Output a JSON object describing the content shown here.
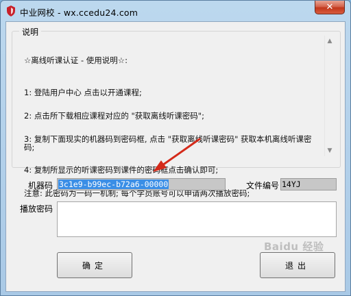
{
  "window": {
    "title": "中业网校 - wx.ccedu24.com",
    "close_symbol": "✕",
    "app_icon": "shield-icon"
  },
  "instructions": {
    "group_title": "说明",
    "heading": "☆离线听课认证 - 使用说明☆:",
    "lines": [
      "1: 登陆用户中心 点击以开通课程;",
      "2: 点击所下载相应课程对应的 \"获取离线听课密码\";",
      "3: 复制下面现实的机器码到密码框, 点击 \"获取离线听课密码\" 获取本机离线听课密码;",
      "4: 复制所显示的听课密码到课件的密码框点击确认即可;",
      "注意: 此密码为一码一机制; 每个学员账号可以申请两次播放密码;"
    ]
  },
  "machine_code": {
    "label": "机器码",
    "value": "3c1e9-b99ec-b72a6-00000"
  },
  "file_number": {
    "label": "文件编号",
    "value": "14YJ"
  },
  "play_password": {
    "label": "播放密码",
    "value": ""
  },
  "buttons": {
    "ok": "确定",
    "exit": "退出"
  },
  "watermark": "Baidu 经验",
  "colors": {
    "selection": "#3a8ee6",
    "annotation_arrow": "#d42a1a",
    "close_button": "#c2371c"
  }
}
